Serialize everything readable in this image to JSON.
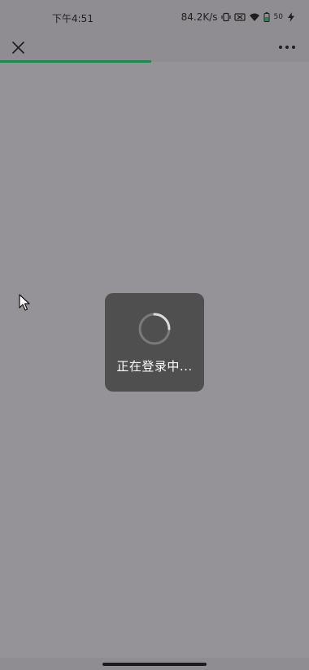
{
  "status_bar": {
    "time": "下午4:51",
    "network_speed": "84.2K/s",
    "battery_level": "50",
    "icons": [
      "vibrate-icon",
      "no-sim-icon",
      "wifi-icon",
      "battery-icon",
      "charging-icon"
    ]
  },
  "nav": {
    "close_icon": "close-icon",
    "more_icon": "more-icon"
  },
  "progress": {
    "value": 0.49,
    "color": "#1b8a4e"
  },
  "loading": {
    "text": "正在登录中..."
  },
  "colors": {
    "overlay": "#959397",
    "toast_bg": "#4f4f50",
    "accent": "#1b8a4e"
  }
}
